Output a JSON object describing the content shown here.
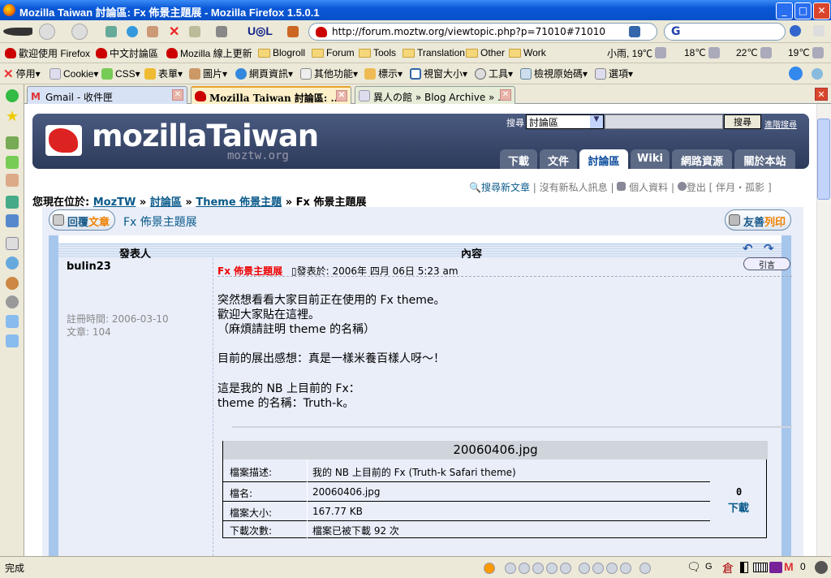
{
  "window": {
    "title": "Mozilla Taiwan 討論區: Fx 佈景主題展 - Mozilla Firefox 1.5.0.1",
    "min": "_",
    "max": "□",
    "close": "✕"
  },
  "navbar": {
    "url": "http://forum.moztw.org/viewtopic.php?p=71010#71010",
    "search_engine": "G"
  },
  "bookmarks": {
    "items": [
      "歡迎使用 Firefox",
      "中文討論區",
      "Mozilla 線上更新",
      "Blogroll",
      "Forum",
      "Tools",
      "Translation",
      "Other",
      "Work"
    ],
    "weather": [
      "小雨, 19℃",
      "18℃",
      "22℃",
      "19℃"
    ]
  },
  "devbar": {
    "items": [
      "停用▾",
      "Cookie▾",
      "CSS▾",
      "表單▾",
      "圖片▾",
      "網頁資訊▾",
      "其他功能▾",
      "標示▾",
      "視窗大小▾",
      "工具▾",
      "檢視原始碼▾",
      "選項▾"
    ]
  },
  "tabs": [
    {
      "label": "Gmail - 收件匣"
    },
    {
      "label": "Mozilla Taiwan 討論區: ..."
    },
    {
      "label": "異人の館 » Blog Archive » ..."
    }
  ],
  "site": {
    "logo": "mozillaTaiwan",
    "logo_sub": "moztw.org",
    "search_label": "搜尋",
    "search_scope": "討論區",
    "search_button": "搜尋",
    "advanced_search": "進階搜尋",
    "nav": [
      "下載",
      "文件",
      "討論區",
      "Wiki",
      "網路資源",
      "關於本站"
    ],
    "userlinks": {
      "search_new": "搜尋新文章",
      "no_pm": "沒有新私人訊息",
      "profile": "個人資料",
      "logout": "登出 [ 伴月・孤影 ]"
    },
    "breadcrumb": {
      "prefix": "您現在位於:",
      "items": [
        "MozTW",
        "討論區",
        "Theme 佈景主題"
      ],
      "current": "Fx 佈景主題展",
      "sep": "»"
    }
  },
  "topic": {
    "reply_a": "回覆",
    "reply_b": "文章",
    "title": "Fx 佈景主題展",
    "print_a": "友善",
    "print_b": "列印",
    "col_author": "發表人",
    "col_content": "內容"
  },
  "post": {
    "author": "bulin23",
    "joined": "註冊時間: 2006-03-10",
    "posts": "文章: 104",
    "subject": "Fx 佈景主題展",
    "posted": "發表於: 2006年 四月 06日 5:23 am",
    "quote": "引言",
    "body": [
      "突然想看看大家目前正在使用的 Fx theme。",
      "歡迎大家貼在這裡。",
      "（麻煩請註明 theme 的名稱）",
      "",
      "目前的展出感想：真是一樣米養百樣人呀～！",
      "",
      "這是我的 NB 上目前的 Fx：",
      "theme 的名稱：Truth-k。"
    ]
  },
  "attachment": {
    "filename_header": "20060406.jpg",
    "rows": [
      {
        "label": "檔案描述:",
        "value": "我的 NB 上目前的 Fx (Truth-k Safari theme)"
      },
      {
        "label": "檔名:",
        "value": "20060406.jpg"
      },
      {
        "label": "檔案大小:",
        "value": "167.77 KB"
      },
      {
        "label": "下載次數:",
        "value": "檔案已被下載 92 次"
      }
    ],
    "icon_text": "0",
    "download": "下載"
  },
  "status": {
    "text": "完成",
    "gmail_count": "0",
    "g": "G"
  }
}
